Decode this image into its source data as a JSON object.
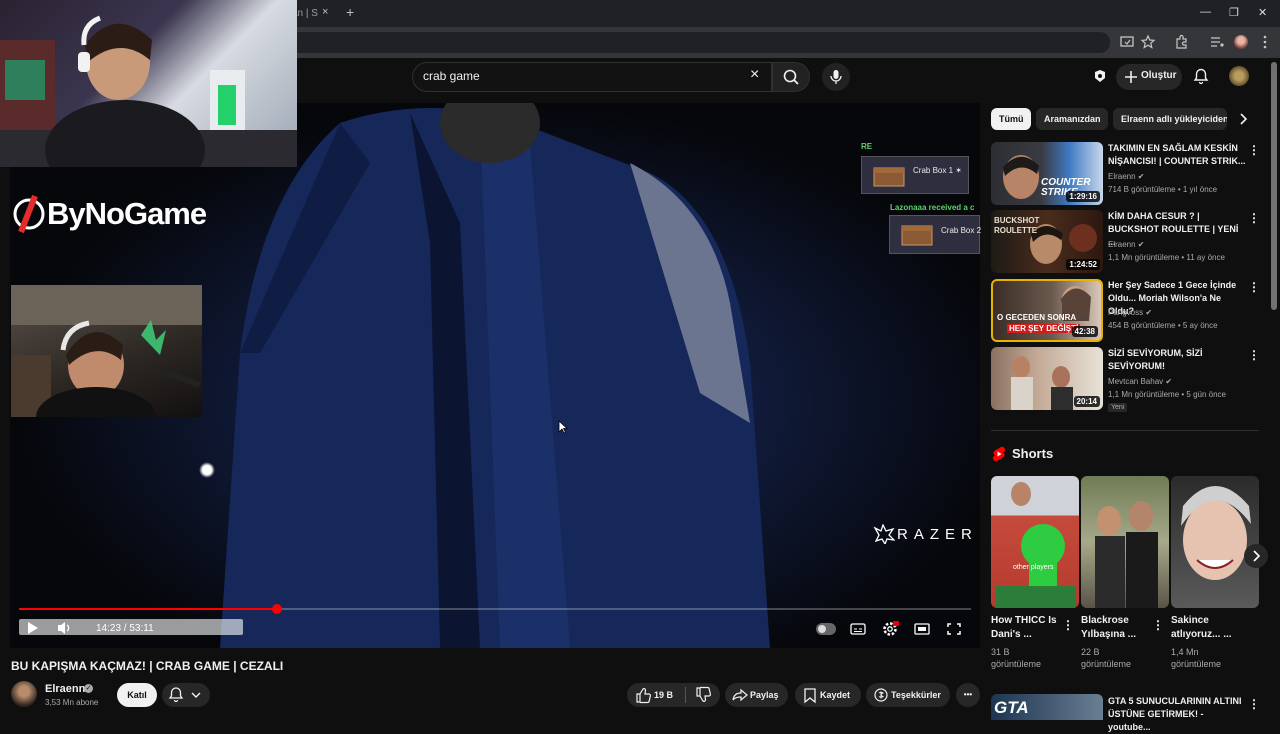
{
  "browser": {
    "tab_title": "an | S",
    "tab_close": "×",
    "new_tab": "+",
    "minimize": "—",
    "maximize": "❐",
    "close": "✕"
  },
  "header": {
    "search_query": "crab game",
    "clear_icon": "×",
    "create_label": "Oluştur"
  },
  "player": {
    "current_time": "14:23",
    "duration": "53:11",
    "time_display": "14:23 / 53:11",
    "progress_fraction": 0.2706
  },
  "overlay": {
    "brand": "ByNoGame",
    "razer": "RAZER",
    "crab_box_1": "Crab Box 1 ✶",
    "crab_box_2": "Crab Box 2",
    "received_notice": "Lazonaaa received a c",
    "partial_notice": "RE"
  },
  "video": {
    "title": "BU KAPIŞMA KAÇMAZ! | CRAB GAME | CEZALI",
    "channel": "Elraenn",
    "subscribers": "3,53 Mn abone",
    "join_label": "Katıl",
    "likes": "19 B",
    "share_label": "Paylaş",
    "save_label": "Kaydet",
    "thanks_label": "Teşekkürler",
    "more_label": "•••"
  },
  "chips": [
    {
      "label": "Tümü",
      "active": true
    },
    {
      "label": "Aramanızdan",
      "active": false
    },
    {
      "label": "Elraenn adlı yükleyiciden",
      "active": false
    }
  ],
  "recommendations": [
    {
      "title": "TAKIMIN EN SAĞLAM KESKİN NİŞANCISI! | COUNTER STRIK...",
      "channel": "Elraenn ✔",
      "meta": "714 B görüntüleme • 1 yıl önce",
      "duration": "1:29:16"
    },
    {
      "title": "KİM DAHA CESUR ? | BUCKSHOT ROULETTE | YENİ ...",
      "channel": "Elraenn ✔",
      "meta": "1,1 Mn görüntüleme • 11 ay önce",
      "duration": "1:24:52"
    },
    {
      "title": "Her Şey Sadece 1 Gece İçinde Oldu... Moriah Wilson'a Ne Oldu?",
      "channel": "Pangvoss ✔",
      "meta": "454 B görüntüleme • 5 ay önce",
      "duration": "42:38"
    },
    {
      "title": "SİZİ SEVİYORUM, SİZİ SEVİYORUM!",
      "channel": "Mevtcan Bahav ✔",
      "meta": "1,1 Mn görüntüleme • 5 gün önce",
      "duration": "20:14",
      "badge": "Yeni"
    }
  ],
  "thumb_text": {
    "cs": "COUNTER STRIKE",
    "buckshot": "BUCKSHOT ROULETTE",
    "night_1": "O GECEDEN SONRA",
    "night_2": "HER ŞEY DEĞİŞTİ"
  },
  "shorts": {
    "header": "Shorts",
    "items": [
      {
        "title": "How THICC Is Dani's ...",
        "views": "31 B görüntüleme",
        "caption": "other players"
      },
      {
        "title": "Blackrose Yılbaşına ...",
        "views": "22 B görüntüleme"
      },
      {
        "title": "Sakince atlıyoruz... ...",
        "views": "1,4 Mn görüntüleme"
      }
    ]
  },
  "bottom_rec": {
    "title": "GTA 5 SUNUCULARININ ALTINI ÜSTÜNE GETİRMEK! - youtube...",
    "thumb_text": "GTA"
  },
  "colors": {
    "accent_red": "#ff0000",
    "background": "#0f0f0f",
    "chip_bg": "#272727",
    "text_primary": "#f1f1f1",
    "text_secondary": "#aaaaaa",
    "donation_green": "#5fd068"
  }
}
